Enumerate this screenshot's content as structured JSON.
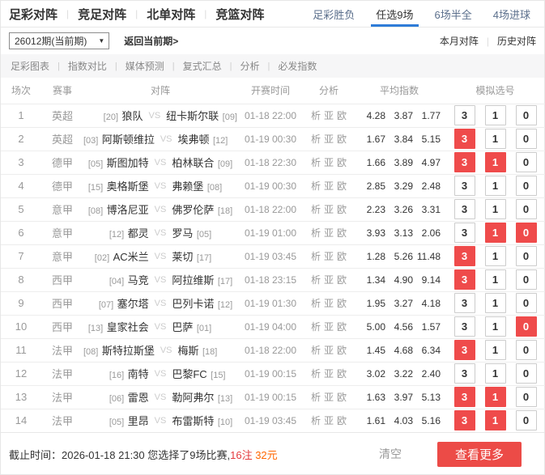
{
  "colors": {
    "accent_blue": "#2e7cd8",
    "select_red": "#ef4b4b",
    "button_red": "#ec4b47",
    "note_red": "#e4393c",
    "amount_orange": "#ff6600"
  },
  "header": {
    "main_tabs": [
      "足彩对阵",
      "竞足对阵",
      "北单对阵",
      "竞篮对阵"
    ],
    "right_tabs": [
      {
        "label": "足彩胜负",
        "active": false
      },
      {
        "label": "任选9场",
        "active": true
      },
      {
        "label": "6场半全",
        "active": false
      },
      {
        "label": "4场进球",
        "active": false
      }
    ]
  },
  "period_bar": {
    "period_value": "26012期(当前期)",
    "dropdown_caret": "▼",
    "back_link": "返回当前期>",
    "month_link": "本月对阵",
    "history_link": "历史对阵"
  },
  "sub_nav": [
    "足彩图表",
    "指数对比",
    "媒体预测",
    "复式汇总",
    "分析",
    "必发指数"
  ],
  "table": {
    "headers": [
      "场次",
      "赛事",
      "对阵",
      "开赛时间",
      "分析",
      "平均指数",
      "模拟选号"
    ],
    "vs_label": "VS",
    "analysis_links": [
      "析",
      "亚",
      "欧"
    ],
    "pick_labels": [
      "3",
      "1",
      "0"
    ],
    "rows": [
      {
        "no": "1",
        "league": "英超",
        "home_rank": "[20]",
        "home": "狼队",
        "away": "纽卡斯尔联",
        "away_rank": "[09]",
        "time": "01-18 22:00",
        "odds": [
          "4.28",
          "3.87",
          "1.77"
        ],
        "selected": [
          false,
          false,
          false
        ]
      },
      {
        "no": "2",
        "league": "英超",
        "home_rank": "[03]",
        "home": "阿斯顿维拉",
        "away": "埃弗顿",
        "away_rank": "[12]",
        "time": "01-19 00:30",
        "odds": [
          "1.67",
          "3.84",
          "5.15"
        ],
        "selected": [
          true,
          false,
          false
        ]
      },
      {
        "no": "3",
        "league": "德甲",
        "home_rank": "[05]",
        "home": "斯图加特",
        "away": "柏林联合",
        "away_rank": "[09]",
        "time": "01-18 22:30",
        "odds": [
          "1.66",
          "3.89",
          "4.97"
        ],
        "selected": [
          true,
          true,
          false
        ]
      },
      {
        "no": "4",
        "league": "德甲",
        "home_rank": "[15]",
        "home": "奥格斯堡",
        "away": "弗赖堡",
        "away_rank": "[08]",
        "time": "01-19 00:30",
        "odds": [
          "2.85",
          "3.29",
          "2.48"
        ],
        "selected": [
          false,
          false,
          false
        ]
      },
      {
        "no": "5",
        "league": "意甲",
        "home_rank": "[08]",
        "home": "博洛尼亚",
        "away": "佛罗伦萨",
        "away_rank": "[18]",
        "time": "01-18 22:00",
        "odds": [
          "2.23",
          "3.26",
          "3.31"
        ],
        "selected": [
          false,
          false,
          false
        ]
      },
      {
        "no": "6",
        "league": "意甲",
        "home_rank": "[12]",
        "home": "都灵",
        "away": "罗马",
        "away_rank": "[05]",
        "time": "01-19 01:00",
        "odds": [
          "3.93",
          "3.13",
          "2.06"
        ],
        "selected": [
          false,
          true,
          true
        ]
      },
      {
        "no": "7",
        "league": "意甲",
        "home_rank": "[02]",
        "home": "AC米兰",
        "away": "莱切",
        "away_rank": "[17]",
        "time": "01-19 03:45",
        "odds": [
          "1.28",
          "5.26",
          "11.48"
        ],
        "selected": [
          true,
          false,
          false
        ]
      },
      {
        "no": "8",
        "league": "西甲",
        "home_rank": "[04]",
        "home": "马竞",
        "away": "阿拉维斯",
        "away_rank": "[17]",
        "time": "01-18 23:15",
        "odds": [
          "1.34",
          "4.90",
          "9.14"
        ],
        "selected": [
          true,
          false,
          false
        ]
      },
      {
        "no": "9",
        "league": "西甲",
        "home_rank": "[07]",
        "home": "塞尔塔",
        "away": "巴列卡诺",
        "away_rank": "[12]",
        "time": "01-19 01:30",
        "odds": [
          "1.95",
          "3.27",
          "4.18"
        ],
        "selected": [
          false,
          false,
          false
        ]
      },
      {
        "no": "10",
        "league": "西甲",
        "home_rank": "[13]",
        "home": "皇家社会",
        "away": "巴萨",
        "away_rank": "[01]",
        "time": "01-19 04:00",
        "odds": [
          "5.00",
          "4.56",
          "1.57"
        ],
        "selected": [
          false,
          false,
          true
        ]
      },
      {
        "no": "11",
        "league": "法甲",
        "home_rank": "[08]",
        "home": "斯特拉斯堡",
        "away": "梅斯",
        "away_rank": "[18]",
        "time": "01-18 22:00",
        "odds": [
          "1.45",
          "4.68",
          "6.34"
        ],
        "selected": [
          true,
          false,
          false
        ]
      },
      {
        "no": "12",
        "league": "法甲",
        "home_rank": "[16]",
        "home": "南特",
        "away": "巴黎FC",
        "away_rank": "[15]",
        "time": "01-19 00:15",
        "odds": [
          "3.02",
          "3.22",
          "2.40"
        ],
        "selected": [
          false,
          false,
          false
        ]
      },
      {
        "no": "13",
        "league": "法甲",
        "home_rank": "[06]",
        "home": "雷恩",
        "away": "勒阿弗尔",
        "away_rank": "[13]",
        "time": "01-19 00:15",
        "odds": [
          "1.63",
          "3.97",
          "5.13"
        ],
        "selected": [
          true,
          true,
          false
        ]
      },
      {
        "no": "14",
        "league": "法甲",
        "home_rank": "[05]",
        "home": "里昂",
        "away": "布雷斯特",
        "away_rank": "[10]",
        "time": "01-19 03:45",
        "odds": [
          "1.61",
          "4.03",
          "5.16"
        ],
        "selected": [
          true,
          true,
          false
        ]
      }
    ]
  },
  "footer": {
    "deadline_prefix": "截止时间：2026-01-18 21:30 您选择了9场比赛,",
    "stake_count": "16注",
    "stake_amount": "32元",
    "clear_label": "清空",
    "more_label": "查看更多"
  }
}
